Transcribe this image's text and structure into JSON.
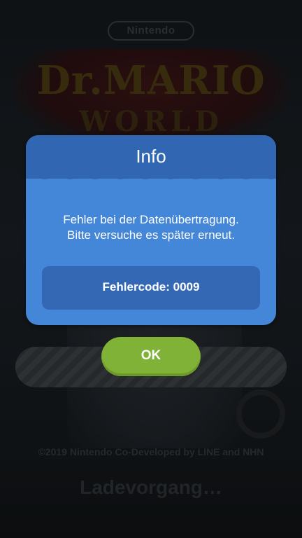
{
  "background": {
    "brand_logo": "Nintendo",
    "game_title_line1": "Dr.MARIO",
    "game_title_line2": "WORLD",
    "copyright": "©2019 Nintendo Co-Developed by LINE and NHN",
    "loading_text": "Ladevorgang…"
  },
  "dialog": {
    "title": "Info",
    "message_line1": "Fehler bei der Datenübertragung.",
    "message_line2": "Bitte versuche es später erneut.",
    "error_code": "Fehlercode: 0009",
    "ok_label": "OK"
  },
  "colors": {
    "dialog_body": "#4486d8",
    "dialog_header": "#3066b2",
    "error_box": "#3568b4",
    "ok_button": "#7fb236"
  }
}
